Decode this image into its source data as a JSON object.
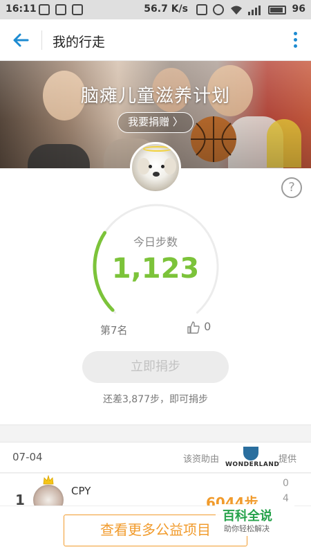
{
  "status_bar": {
    "time": "16:11",
    "network_speed": "56.7 K/s",
    "battery": "96"
  },
  "app_bar": {
    "title": "我的行走"
  },
  "banner": {
    "title": "脑瘫儿童滋养计划",
    "donate_label": "我要捐赠 〉"
  },
  "steps": {
    "label": "今日步数",
    "value": "1,123",
    "progress_fraction": 0.29,
    "rank": "第7名",
    "likes": "0",
    "donate_button": "立即捐步",
    "remaining_note": "还差3,877步，即可捐步"
  },
  "sponsor": {
    "date": "07-04",
    "funded_label": "该资助由",
    "sponsor_logo_text": "WONDERLAND",
    "provide_label": "提供"
  },
  "ranking": [
    {
      "rank": "1",
      "name": "CPY",
      "steps": "6044步",
      "count_top": "0",
      "count_bottom": "4"
    }
  ],
  "bottom": {
    "more_projects": "查看更多公益项目"
  },
  "watermark": {
    "title": "百科全说",
    "subtitle": "助你轻松解决"
  },
  "colors": {
    "accent_blue": "#1d8bd1",
    "progress_green": "#7cc33a",
    "orange": "#f19b2c"
  }
}
